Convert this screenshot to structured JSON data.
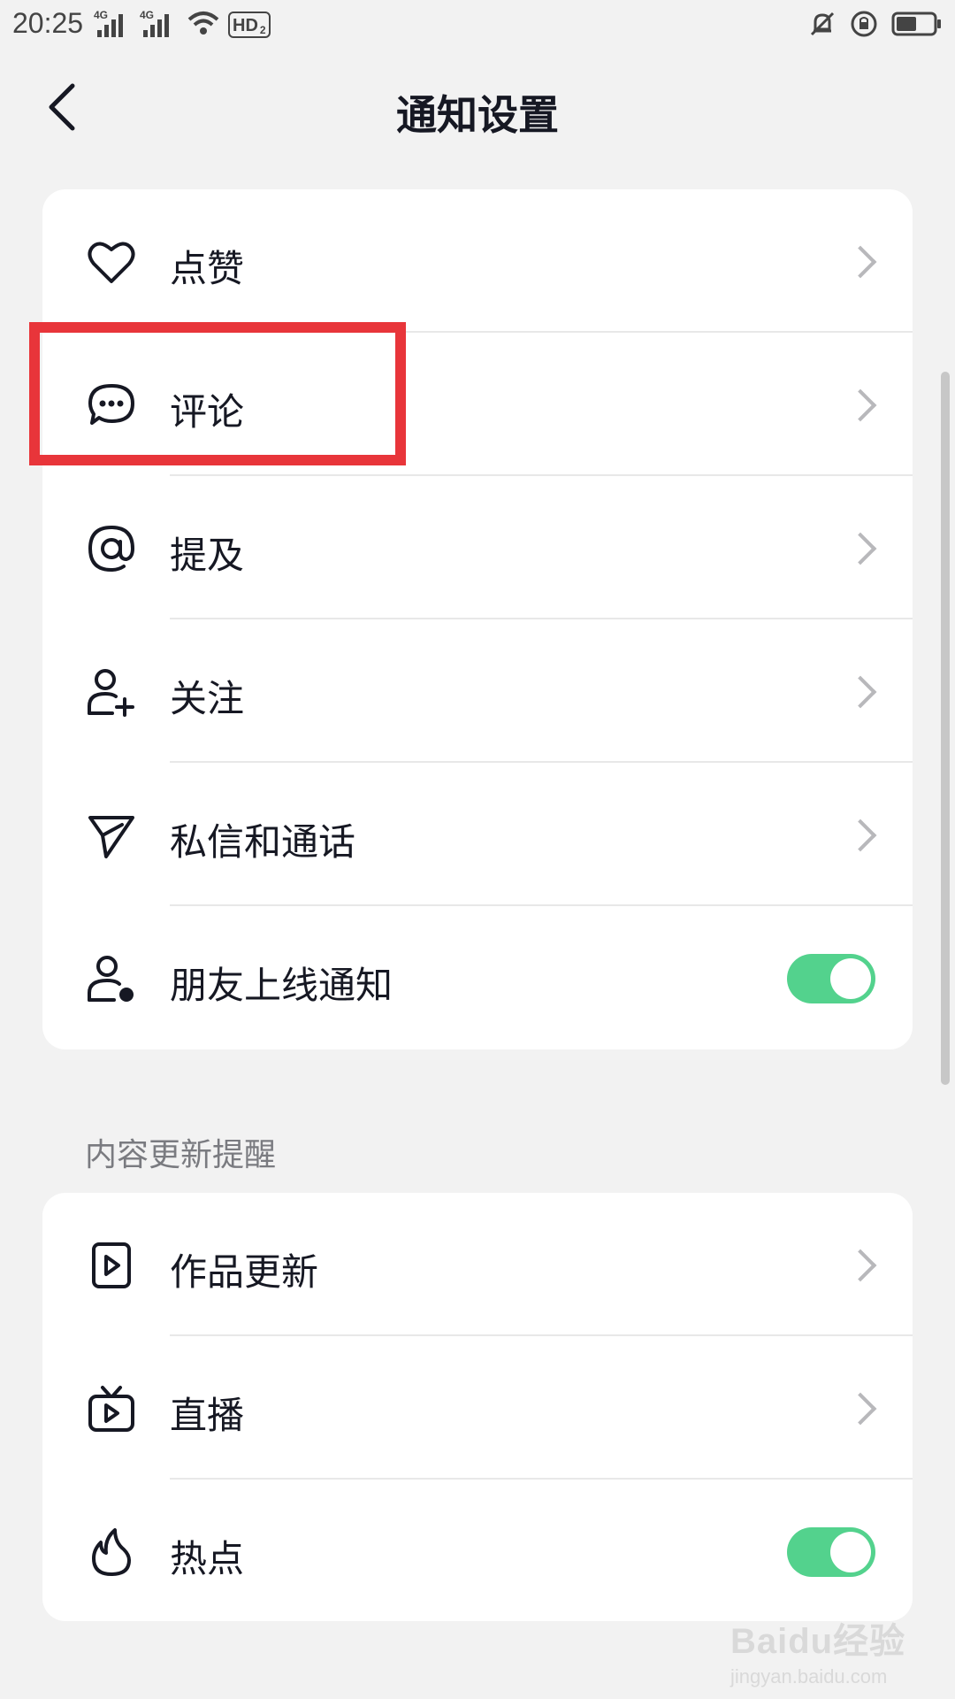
{
  "status_bar": {
    "time": "20:25",
    "net1": "4G",
    "net2": "4G",
    "hd": "HD",
    "hd_sub": "2"
  },
  "header": {
    "title": "通知设置"
  },
  "section1": {
    "items": [
      {
        "label": "点赞",
        "icon": "heart-icon",
        "control": "chevron"
      },
      {
        "label": "评论",
        "icon": "comment-icon",
        "control": "chevron"
      },
      {
        "label": "提及",
        "icon": "at-icon",
        "control": "chevron"
      },
      {
        "label": "关注",
        "icon": "follow-user-icon",
        "control": "chevron"
      },
      {
        "label": "私信和通话",
        "icon": "send-icon",
        "control": "chevron"
      },
      {
        "label": "朋友上线通知",
        "icon": "user-online-icon",
        "control": "toggle",
        "toggle_on": true
      }
    ]
  },
  "section2": {
    "title": "内容更新提醒",
    "items": [
      {
        "label": "作品更新",
        "icon": "video-icon",
        "control": "chevron"
      },
      {
        "label": "直播",
        "icon": "tv-icon",
        "control": "chevron"
      },
      {
        "label": "热点",
        "icon": "flame-icon",
        "control": "toggle",
        "toggle_on": true
      }
    ]
  },
  "watermark": {
    "main": "Baidu经验",
    "sub": "jingyan.baidu.com"
  },
  "colors": {
    "background": "#f2f2f2",
    "card": "#ffffff",
    "text": "#161823",
    "toggle_on": "#53d28d",
    "highlight": "#e8353a"
  }
}
